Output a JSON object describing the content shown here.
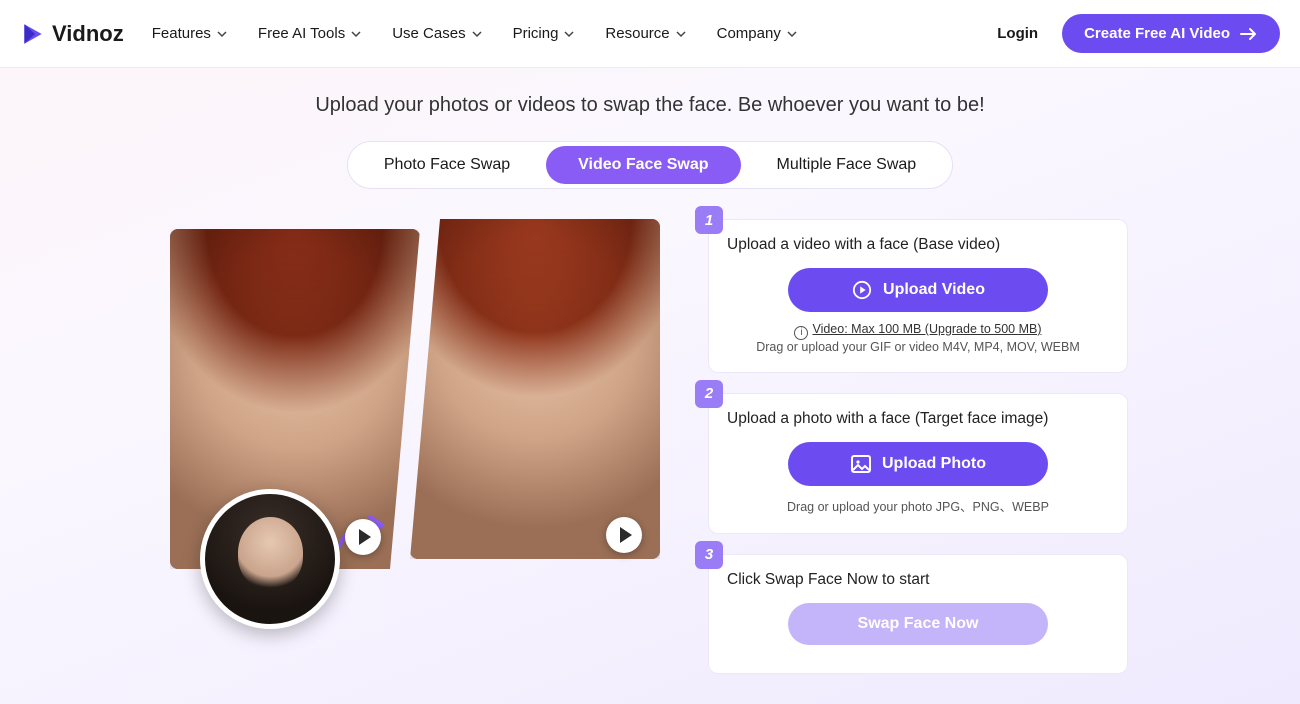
{
  "brand": "Vidnoz",
  "nav": {
    "items": [
      "Features",
      "Free AI Tools",
      "Use Cases",
      "Pricing",
      "Resource",
      "Company"
    ],
    "login": "Login",
    "cta": "Create Free AI Video"
  },
  "hero": {
    "subtitle": "Upload your photos or videos to swap the face. Be whoever you want to be!"
  },
  "tabs": {
    "photo": "Photo Face Swap",
    "video": "Video Face Swap",
    "multiple": "Multiple Face Swap"
  },
  "steps": {
    "s1": {
      "num": "1",
      "title": "Upload a video with a face (Base video)",
      "button": "Upload Video",
      "limit": "Video: Max 100 MB (Upgrade to 500 MB)",
      "hint": "Drag or upload your GIF or video M4V, MP4, MOV, WEBM"
    },
    "s2": {
      "num": "2",
      "title": "Upload a photo with a face (Target face image)",
      "button": "Upload Photo",
      "hint": "Drag or upload your photo JPG、PNG、WEBP"
    },
    "s3": {
      "num": "3",
      "title": "Click Swap Face Now to start",
      "button": "Swap Face Now"
    }
  }
}
